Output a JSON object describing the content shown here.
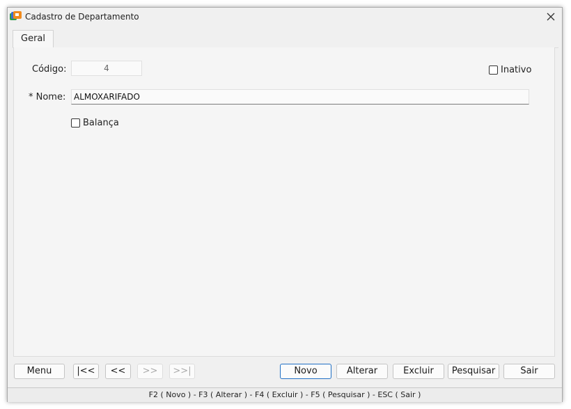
{
  "window": {
    "title": "Cadastro de Departamento",
    "icon": "app-logo-icon",
    "close_icon": "close-icon"
  },
  "tabs": [
    {
      "label": "Geral",
      "active": true
    }
  ],
  "form": {
    "codigo_label": "Código:",
    "codigo_value": "4",
    "nome_label": "* Nome:",
    "nome_value": "ALMOXARIFADO",
    "inativo_label": "Inativo",
    "inativo_checked": false,
    "balanca_label": "Balança",
    "balanca_checked": false
  },
  "buttons": {
    "menu": "Menu",
    "first": "|<<",
    "prev": "<<",
    "next": ">>",
    "last": ">>|",
    "novo": "Novo",
    "alterar": "Alterar",
    "excluir": "Excluir",
    "pesquisar": "Pesquisar",
    "sair": "Sair"
  },
  "statusbar": {
    "text": "F2 ( Novo )  -  F3 ( Alterar )  -  F4 ( Excluir )  -  F5 ( Pesquisar )  -  ESC ( Sair )"
  },
  "colors": {
    "window_bg": "#f0f0f0",
    "default_button_border": "#1f6fc5",
    "disabled_text": "#aaaaaa"
  }
}
